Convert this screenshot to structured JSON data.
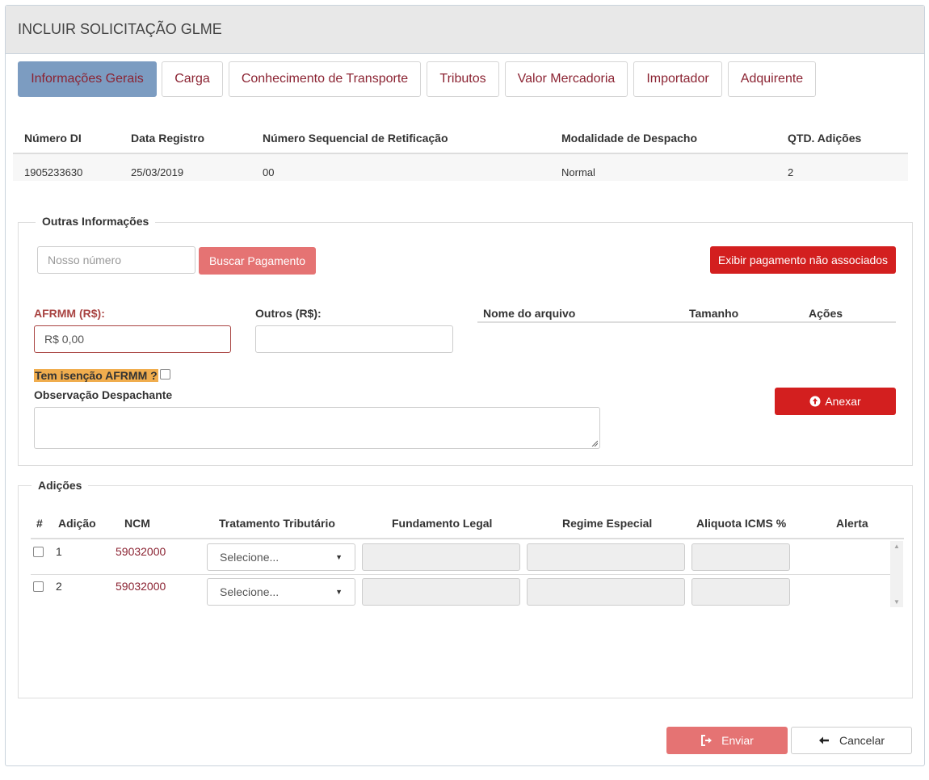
{
  "header": {
    "title": "INCLUIR SOLICITAÇÃO GLME"
  },
  "tabs": [
    {
      "label": "Informações Gerais"
    },
    {
      "label": "Carga"
    },
    {
      "label": "Conhecimento de Transporte"
    },
    {
      "label": "Tributos"
    },
    {
      "label": "Valor Mercadoria"
    },
    {
      "label": "Importador"
    },
    {
      "label": "Adquirente"
    }
  ],
  "di_table": {
    "headers": [
      "Número DI",
      "Data Registro",
      "Número Sequencial de Retificação",
      "Modalidade de Despacho",
      "QTD. Adições"
    ],
    "row": [
      "1905233630",
      "25/03/2019",
      "00",
      "Normal",
      "2"
    ]
  },
  "outras": {
    "legend": "Outras Informações",
    "nosso_numero_placeholder": "Nosso número",
    "buscar_label": "Buscar Pagamento",
    "exibir_label": "Exibir pagamento não associados",
    "afrmm_label": "AFRMM (R$):",
    "afrmm_value": "R$ 0,00",
    "outros_label": "Outros (R$):",
    "outros_value": "",
    "file_headers": [
      "Nome do arquivo",
      "Tamanho",
      "Ações"
    ],
    "isencao_label": "Tem isenção AFRMM ?",
    "obs_label": "Observação Despachante",
    "anexar_label": "Anexar"
  },
  "adicoes": {
    "legend": "Adições",
    "headers": [
      "#",
      "Adição",
      "NCM",
      "Tratamento Tributário",
      "Fundamento Legal",
      "Regime Especial",
      "Aliquota ICMS %",
      "Alerta"
    ],
    "rows": [
      {
        "adicao": "1",
        "ncm": "59032000",
        "tratamento": "Selecione..."
      },
      {
        "adicao": "2",
        "ncm": "59032000",
        "tratamento": "Selecione..."
      }
    ]
  },
  "footer": {
    "enviar_label": "Enviar",
    "cancelar_label": "Cancelar"
  },
  "colors": {
    "accent_red": "#d31f1f",
    "light_red": "#e57373",
    "active_tab": "#7c9cc1",
    "text_red": "#8b2332",
    "highlight": "#f0ad4e"
  }
}
